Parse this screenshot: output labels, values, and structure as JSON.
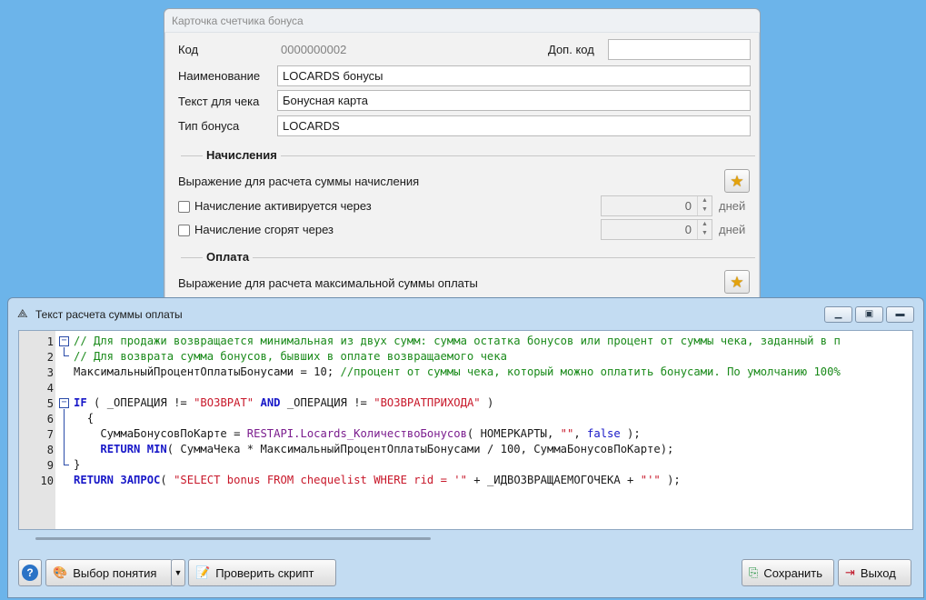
{
  "card": {
    "title": "Карточка счетчика бонуса",
    "code_label": "Код",
    "code_value": "0000000002",
    "extra_code_label": "Доп. код",
    "extra_code_value": "",
    "name_label": "Наименование",
    "name_value": "LOCARDS бонусы",
    "receipt_label": "Текст для чека",
    "receipt_value": "Бонусная карта",
    "bonus_type_label": "Тип бонуса",
    "bonus_type_value": "LOCARDS",
    "accrual_section": "Начисления",
    "accrual_expr_label": "Выражение для расчета суммы начисления",
    "activate_label": "Начисление активируется через",
    "activate_value": "0",
    "expire_label": "Начисление сгорят  через",
    "expire_value": "0",
    "days_label": "дней",
    "payment_section": "Оплата",
    "payment_expr_label": "Выражение для расчета максимальной суммы оплаты"
  },
  "editor": {
    "title": "Текст расчета суммы оплаты",
    "line_numbers": [
      "1",
      "2",
      "3",
      "4",
      "5",
      "6",
      "7",
      "8",
      "9",
      "10"
    ]
  },
  "code": {
    "l1": "// Для продажи возвращается минимальная из двух сумм: сумма остатка бонусов или процент от суммы чека, заданный в п",
    "l2": "// Для возврата сумма бонусов, бывших в оплате возвращаемого чека",
    "l3_a": "МаксимальныйПроцентОплатыБонусами = 10; ",
    "l3_b": "//процент от суммы чека, который можно оплатить бонусами. По умолчанию 100%",
    "l5_if": "IF",
    "l5_a": " ( _ОПЕРАЦИЯ != ",
    "l5_s1": "\"ВОЗВРАТ\"",
    "l5_and": "AND",
    "l5_b": " _ОПЕРАЦИЯ != ",
    "l5_s2": "\"ВОЗВРАТПРИХОДА\"",
    "l5_c": " )",
    "l6": "{",
    "l7_a": "    СуммаБонусовПоКарте = ",
    "l7_fn": "RESTAPI.Locards_КоличествоБонусов",
    "l7_b": "( НОМЕРКАРТЫ, ",
    "l7_s": "\"\"",
    "l7_c": ", ",
    "l7_f": "false",
    "l7_d": " );",
    "l8_ret": "RETURN",
    "l8_min": "MIN",
    "l8_a": "( СуммаЧека * МаксимальныйПроцентОплатыБонусами / 100, СуммаБонусовПоКарте);",
    "l9": "}",
    "l10_ret": "RETURN",
    "l10_q": "ЗАПРОС",
    "l10_a": "( ",
    "l10_s": "\"SELECT bonus FROM chequelist WHERE rid = '\"",
    "l10_b": " + _ИДВОЗВРАЩАЕМОГОЧЕКА + ",
    "l10_s2": "\"'\"",
    "l10_c": " );"
  },
  "toolbar": {
    "choose_concept": "Выбор понятия",
    "check_script": "Проверить скрипт",
    "save": "Сохранить",
    "exit": "Выход"
  },
  "icons": {
    "help": "help-icon",
    "star": "star-icon",
    "save": "save-icon",
    "exit": "exit-icon"
  }
}
